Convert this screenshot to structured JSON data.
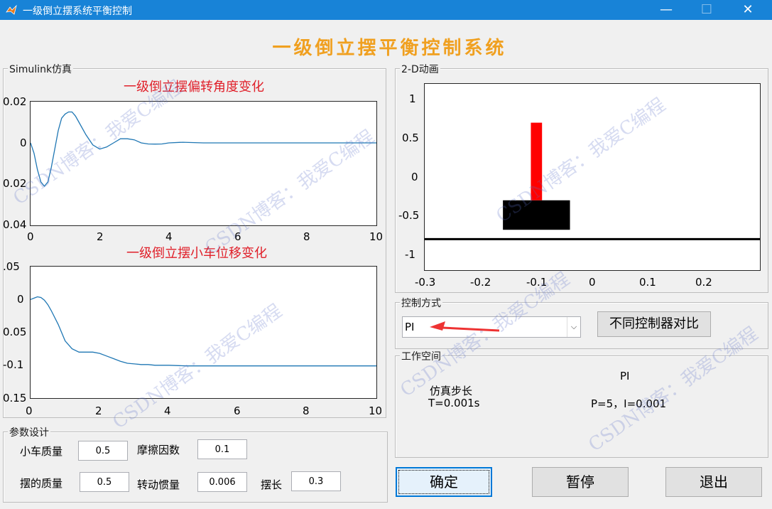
{
  "window": {
    "title": "一级倒立摆系统平衡控制",
    "minimize": "—",
    "maximize": "☐",
    "close": "✕"
  },
  "main_title": "一级倒立摆平衡控制系统",
  "simulink_panel": {
    "label": "Simulink仿真",
    "angle_plot_title": "一级倒立摆偏转角度变化",
    "disp_plot_title": "一级倒立摆小车位移变化"
  },
  "animation_panel": {
    "label": "2-D动画"
  },
  "control": {
    "label": "控制方式",
    "selected": "PI",
    "compare_button": "不同控制器对比"
  },
  "workspace": {
    "label": "工作空间",
    "controller_name": "PI",
    "step_label": "仿真步长",
    "step_value": "T=0.001s",
    "params": "P=5，I=0.001"
  },
  "params_panel": {
    "label": "参数设计",
    "cart_mass_label": "小车质量",
    "cart_mass": "0.5",
    "friction_label": "摩擦因数",
    "friction": "0.1",
    "pend_mass_label": "摆的质量",
    "pend_mass": "0.5",
    "inertia_label": "转动惯量",
    "inertia": "0.006",
    "length_label": "摆长",
    "length": "0.3"
  },
  "buttons": {
    "confirm": "确定",
    "pause": "暂停",
    "exit": "退出"
  },
  "watermark": "CSDN博客：我爱C编程",
  "colors": {
    "titlebar": "#1883d7",
    "main_title": "#f0a020",
    "plot_title": "#e0202a",
    "line": "#1f77b4",
    "pendulum": "#ff0000",
    "cart": "#000000"
  },
  "chart_data": [
    {
      "type": "line",
      "title": "一级倒立摆偏转角度变化",
      "xlim": [
        0,
        10
      ],
      "ylim": [
        -0.04,
        0.02
      ],
      "xticks": [
        "0",
        "2",
        "4",
        "6",
        "8",
        "10"
      ],
      "yticks": [
        "0.02",
        "0",
        "0.02",
        "0.04"
      ],
      "x": [
        0,
        0.1,
        0.2,
        0.3,
        0.4,
        0.5,
        0.6,
        0.7,
        0.8,
        0.9,
        1.0,
        1.1,
        1.2,
        1.3,
        1.4,
        1.6,
        1.8,
        2.0,
        2.2,
        2.4,
        2.6,
        2.8,
        3.0,
        3.2,
        3.4,
        3.6,
        3.8,
        4.0,
        4.4,
        5,
        6,
        7,
        8,
        9,
        10
      ],
      "values": [
        0,
        -0.005,
        -0.013,
        -0.019,
        -0.021,
        -0.019,
        -0.012,
        -0.003,
        0.006,
        0.012,
        0.014,
        0.015,
        0.015,
        0.013,
        0.01,
        0.004,
        -0.001,
        -0.003,
        -0.002,
        0,
        0.002,
        0.002,
        0.0015,
        0,
        -0.0005,
        -0.0006,
        -0.0005,
        0,
        0.0003,
        0,
        0,
        0,
        0,
        0,
        0
      ]
    },
    {
      "type": "line",
      "title": "一级倒立摆小车位移变化",
      "xlim": [
        0,
        10
      ],
      "ylim": [
        -0.15,
        0.05
      ],
      "xticks": [
        "0",
        "2",
        "4",
        "6",
        "8",
        "10"
      ],
      "yticks": [
        ".05",
        "0",
        "0.05",
        "-0.1",
        "0.15"
      ],
      "x": [
        0,
        0.1,
        0.2,
        0.3,
        0.4,
        0.5,
        0.6,
        0.8,
        1.0,
        1.2,
        1.4,
        1.6,
        1.8,
        2.0,
        2.2,
        2.4,
        2.6,
        2.8,
        3.0,
        3.2,
        3.4,
        3.6,
        4.0,
        4.5,
        5,
        6,
        7,
        8,
        9,
        10
      ],
      "values": [
        0,
        0.002,
        0.004,
        0.003,
        -0.001,
        -0.008,
        -0.017,
        -0.038,
        -0.063,
        -0.075,
        -0.08,
        -0.08,
        -0.08,
        -0.082,
        -0.086,
        -0.09,
        -0.094,
        -0.097,
        -0.098,
        -0.099,
        -0.099,
        -0.1,
        -0.1,
        -0.101,
        -0.101,
        -0.101,
        -0.101,
        -0.101,
        -0.101,
        -0.101
      ]
    },
    {
      "type": "scatter",
      "title": "",
      "xlim": [
        -0.3,
        0.3
      ],
      "ylim": [
        -1.2,
        1.2
      ],
      "xticks": [
        "-0.3",
        "-0.2",
        "-0.1",
        "0",
        "0.1",
        "0.2"
      ],
      "yticks": [
        "1",
        "0.5",
        "0",
        "-0.5",
        "-1"
      ],
      "track_y": -0.8,
      "cart": {
        "x_center": -0.1,
        "width": 0.12,
        "y_bottom": -0.68,
        "y_top": -0.3
      },
      "pendulum": {
        "x_center": -0.1,
        "width": 0.02,
        "y_bottom": -0.3,
        "y_top": 0.7
      }
    }
  ]
}
